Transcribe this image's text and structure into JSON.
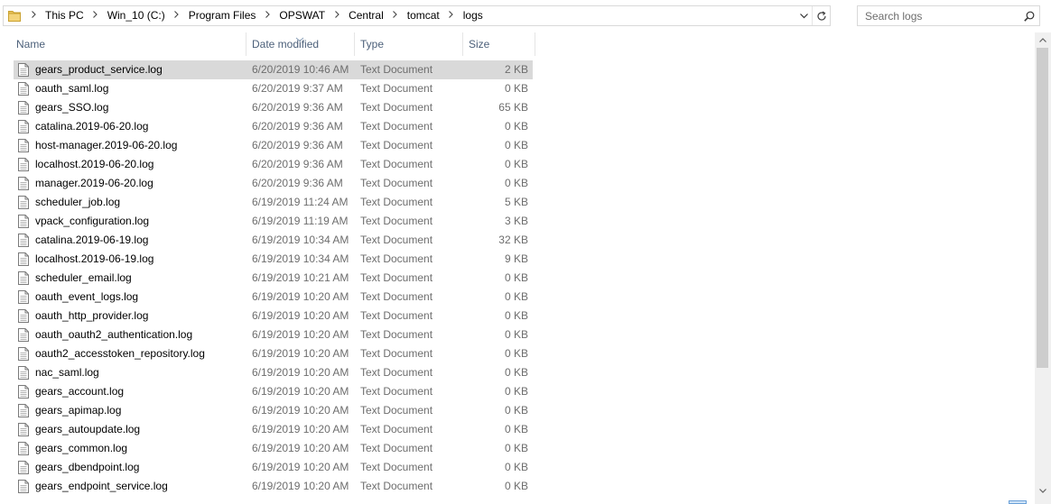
{
  "address": {
    "crumbs": [
      "This PC",
      "Win_10 (C:)",
      "Program Files",
      "OPSWAT",
      "Central",
      "tomcat",
      "logs"
    ]
  },
  "search": {
    "placeholder": "Search logs"
  },
  "columns": {
    "name": "Name",
    "date": "Date modified",
    "type": "Type",
    "size": "Size"
  },
  "files": [
    {
      "name": "gears_product_service.log",
      "date": "6/20/2019 10:46 AM",
      "type": "Text Document",
      "size": "2 KB"
    },
    {
      "name": "oauth_saml.log",
      "date": "6/20/2019 9:37 AM",
      "type": "Text Document",
      "size": "0 KB"
    },
    {
      "name": "gears_SSO.log",
      "date": "6/20/2019 9:36 AM",
      "type": "Text Document",
      "size": "65 KB"
    },
    {
      "name": "catalina.2019-06-20.log",
      "date": "6/20/2019 9:36 AM",
      "type": "Text Document",
      "size": "0 KB"
    },
    {
      "name": "host-manager.2019-06-20.log",
      "date": "6/20/2019 9:36 AM",
      "type": "Text Document",
      "size": "0 KB"
    },
    {
      "name": "localhost.2019-06-20.log",
      "date": "6/20/2019 9:36 AM",
      "type": "Text Document",
      "size": "0 KB"
    },
    {
      "name": "manager.2019-06-20.log",
      "date": "6/20/2019 9:36 AM",
      "type": "Text Document",
      "size": "0 KB"
    },
    {
      "name": "scheduler_job.log",
      "date": "6/19/2019 11:24 AM",
      "type": "Text Document",
      "size": "5 KB"
    },
    {
      "name": "vpack_configuration.log",
      "date": "6/19/2019 11:19 AM",
      "type": "Text Document",
      "size": "3 KB"
    },
    {
      "name": "catalina.2019-06-19.log",
      "date": "6/19/2019 10:34 AM",
      "type": "Text Document",
      "size": "32 KB"
    },
    {
      "name": "localhost.2019-06-19.log",
      "date": "6/19/2019 10:34 AM",
      "type": "Text Document",
      "size": "9 KB"
    },
    {
      "name": "scheduler_email.log",
      "date": "6/19/2019 10:21 AM",
      "type": "Text Document",
      "size": "0 KB"
    },
    {
      "name": "oauth_event_logs.log",
      "date": "6/19/2019 10:20 AM",
      "type": "Text Document",
      "size": "0 KB"
    },
    {
      "name": "oauth_http_provider.log",
      "date": "6/19/2019 10:20 AM",
      "type": "Text Document",
      "size": "0 KB"
    },
    {
      "name": "oauth_oauth2_authentication.log",
      "date": "6/19/2019 10:20 AM",
      "type": "Text Document",
      "size": "0 KB"
    },
    {
      "name": "oauth2_accesstoken_repository.log",
      "date": "6/19/2019 10:20 AM",
      "type": "Text Document",
      "size": "0 KB"
    },
    {
      "name": "nac_saml.log",
      "date": "6/19/2019 10:20 AM",
      "type": "Text Document",
      "size": "0 KB"
    },
    {
      "name": "gears_account.log",
      "date": "6/19/2019 10:20 AM",
      "type": "Text Document",
      "size": "0 KB"
    },
    {
      "name": "gears_apimap.log",
      "date": "6/19/2019 10:20 AM",
      "type": "Text Document",
      "size": "0 KB"
    },
    {
      "name": "gears_autoupdate.log",
      "date": "6/19/2019 10:20 AM",
      "type": "Text Document",
      "size": "0 KB"
    },
    {
      "name": "gears_common.log",
      "date": "6/19/2019 10:20 AM",
      "type": "Text Document",
      "size": "0 KB"
    },
    {
      "name": "gears_dbendpoint.log",
      "date": "6/19/2019 10:20 AM",
      "type": "Text Document",
      "size": "0 KB"
    },
    {
      "name": "gears_endpoint_service.log",
      "date": "6/19/2019 10:20 AM",
      "type": "Text Document",
      "size": "0 KB"
    }
  ],
  "selected_index": 0,
  "icons": {
    "folder": "folder-icon",
    "file": "text-document-icon",
    "search": "search-icon",
    "refresh": "refresh-icon",
    "dropdown": "chevron-down-icon"
  },
  "colors": {
    "header_text": "#4c607a",
    "selected_row": "#d9d9d9",
    "secondary_text": "#6d6d6d",
    "folder": "#e8c15a"
  }
}
